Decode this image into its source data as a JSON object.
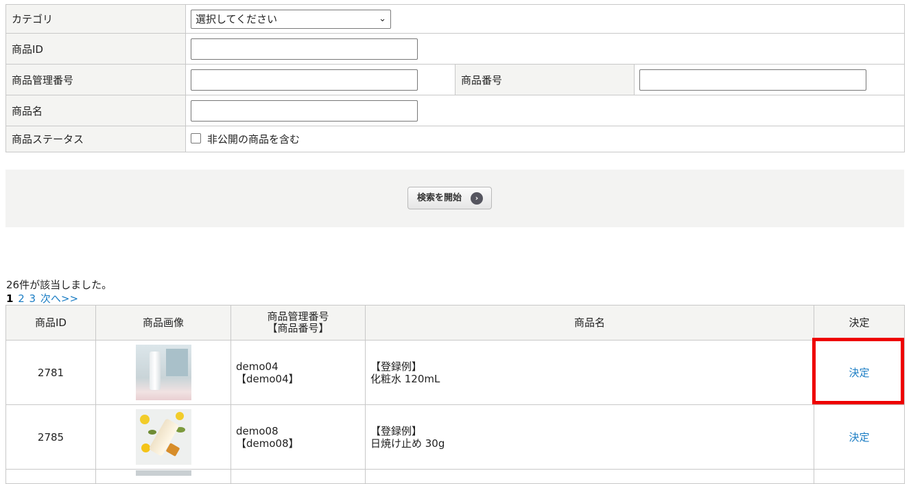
{
  "search": {
    "category_label": "カテゴリ",
    "category_selected": "選択してください",
    "product_id_label": "商品ID",
    "product_code_label": "商品管理番号",
    "product_number_label": "商品番号",
    "product_name_label": "商品名",
    "product_status_label": "商品ステータス",
    "include_private_label": "非公開の商品を含む",
    "button_label": "検索を開始"
  },
  "results": {
    "count_text": "26件が該当しました。",
    "pager": {
      "current": "1",
      "page2": "2",
      "page3": "3",
      "next": "次へ>>"
    },
    "headers": {
      "id": "商品ID",
      "image": "商品画像",
      "code_line1": "商品管理番号",
      "code_line2": "【商品番号】",
      "name": "商品名",
      "decide": "決定"
    },
    "rows": [
      {
        "id": "2781",
        "code": "demo04",
        "number": "【demo04】",
        "name_line1": "【登録例】",
        "name_line2": "化粧水 120mL",
        "decide": "決定"
      },
      {
        "id": "2785",
        "code": "demo08",
        "number": "【demo08】",
        "name_line1": "【登録例】",
        "name_line2": "日焼け止め 30g",
        "decide": "決定"
      }
    ]
  },
  "colors": {
    "link": "#1b7dc4",
    "highlight": "#ee0000",
    "label_bg": "#f4f4f2"
  }
}
